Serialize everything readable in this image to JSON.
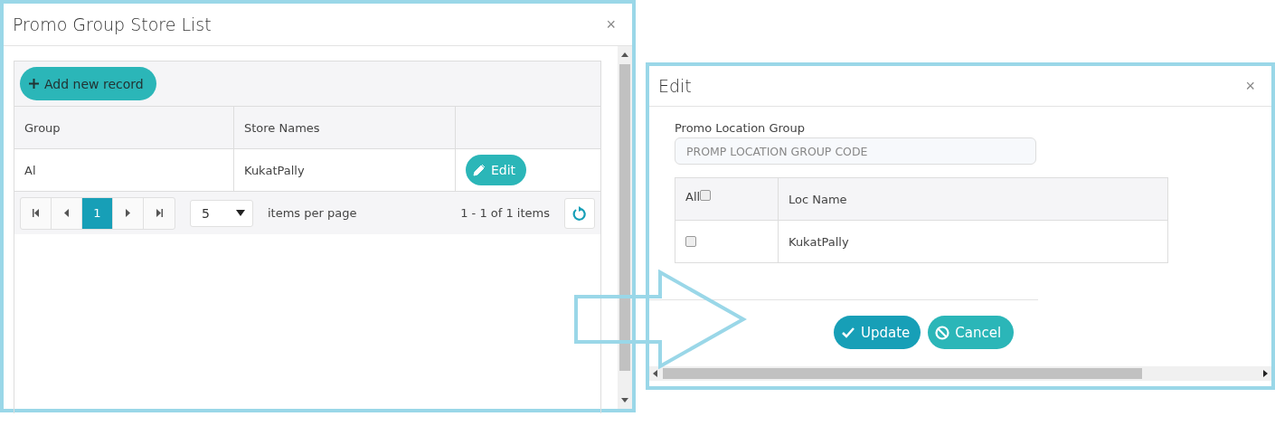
{
  "list_dialog": {
    "title": "Promo Group Store List",
    "close": "×",
    "toolbar": {
      "add_button": "Add new record"
    },
    "table": {
      "columns": [
        "Group",
        "Store Names"
      ],
      "rows": [
        {
          "group": "Al",
          "store_names": "KukatPally",
          "action": "Edit"
        }
      ]
    },
    "pager": {
      "pages": [
        {
          "label": "1",
          "selected": true
        }
      ],
      "page_size": "5",
      "page_size_label": "items per page",
      "info": "1 - 1 of 1 items"
    }
  },
  "edit_dialog": {
    "title": "Edit",
    "close": "×",
    "field": {
      "label": "Promo Location Group",
      "placeholder": "PROMP LOCATION GROUP CODE"
    },
    "table": {
      "select_all": {
        "label": "All",
        "checked": false
      },
      "columns": [
        "Loc Name"
      ],
      "rows": [
        {
          "checked": false,
          "loc_name": "KukatPally"
        }
      ]
    },
    "buttons": [
      {
        "kind": "update",
        "label": "Update"
      },
      {
        "kind": "cancel",
        "label": "Cancel"
      }
    ]
  }
}
